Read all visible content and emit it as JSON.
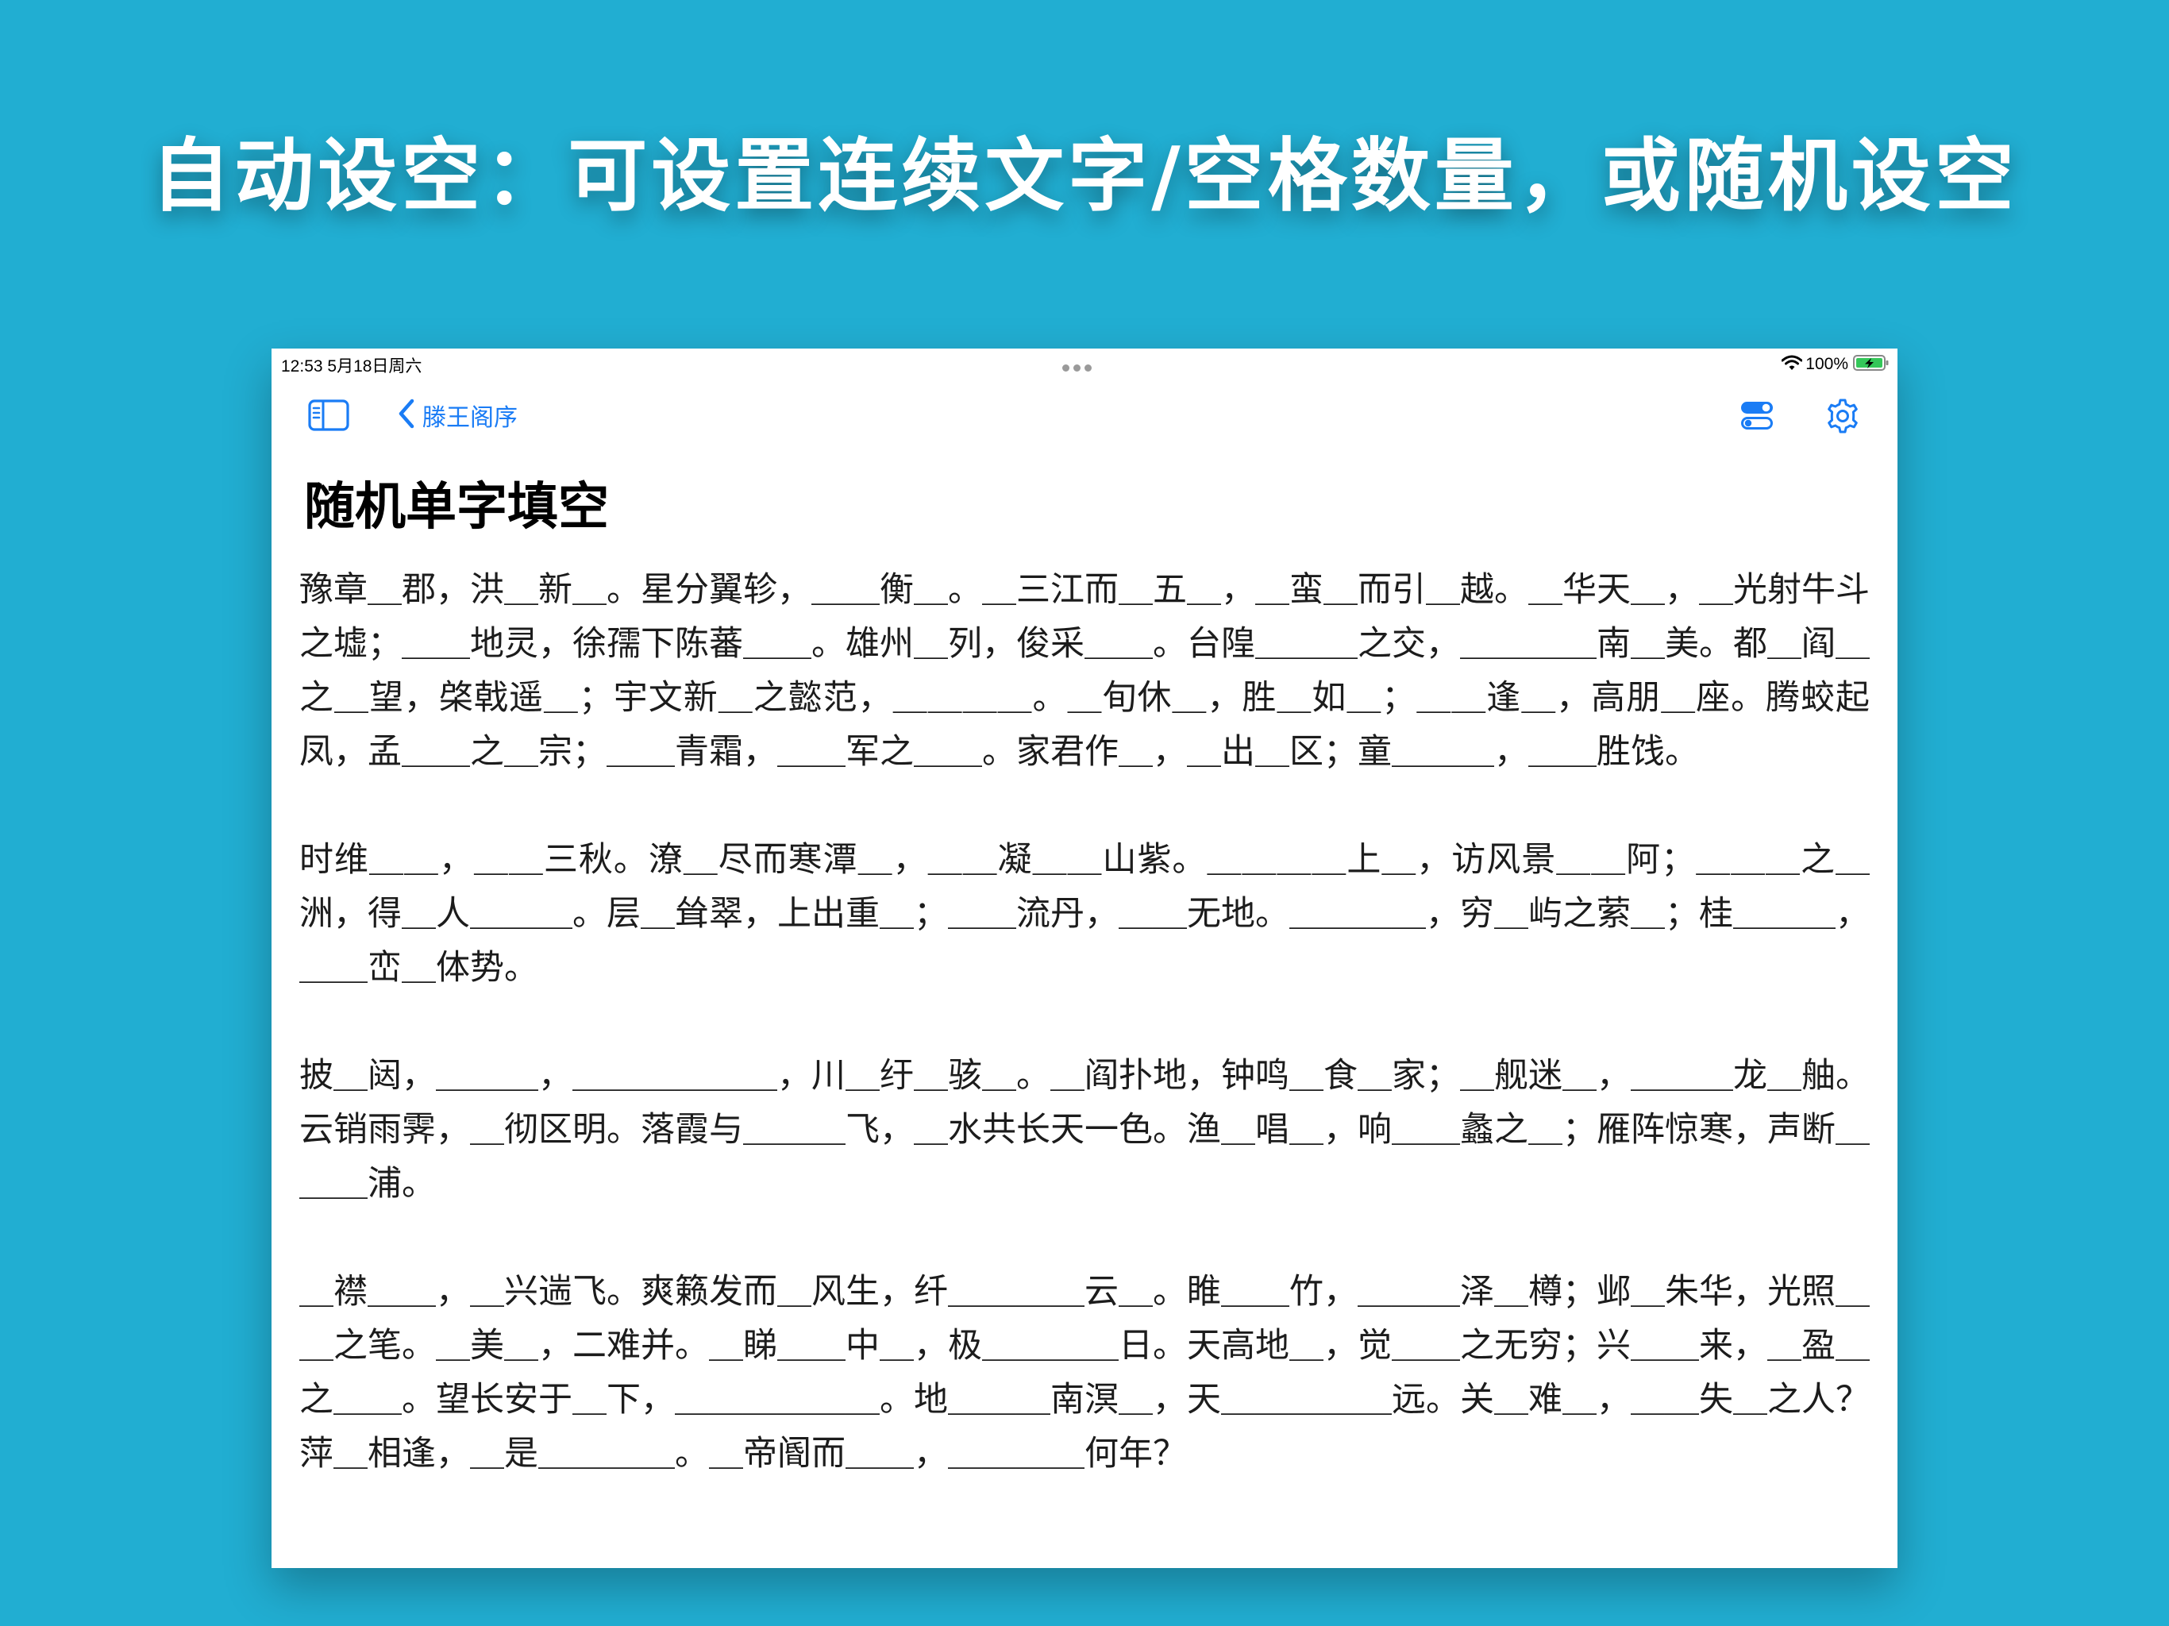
{
  "headline": "自动设空：可设置连续文字/空格数量，或随机设空",
  "status_bar": {
    "time_date": "12:53  5月18日周六",
    "battery": "100%"
  },
  "nav": {
    "back_label": "滕王阁序"
  },
  "page": {
    "title": "随机单字填空"
  },
  "paragraphs": [
    "豫章＿郡，洪＿新＿。星分翼轸，＿＿衡＿。＿三江而＿五＿，＿蛮＿而引＿越。＿华天＿，＿光射牛斗之墟；＿＿地灵，徐孺下陈蕃＿＿。雄州＿列，俊采＿＿。台隍＿＿＿之交，＿＿＿＿南＿美。都＿阎＿之＿望，棨戟遥＿；宇文新＿之懿范，＿＿＿＿。＿旬休＿，胜＿如＿；＿＿逢＿，高朋＿座。腾蛟起凤，孟＿＿之＿宗；＿＿青霜，＿＿军之＿＿。家君作＿，＿出＿区；童＿＿＿，＿＿胜饯。",
    "时维＿＿，＿＿三秋。潦＿尽而寒潭＿，＿＿凝＿＿山紫。＿＿＿＿上＿，访风景＿＿阿；＿＿＿之＿洲，得＿人＿＿＿。层＿耸翠，上出重＿；＿＿流丹，＿＿无地。＿＿＿＿，穷＿屿之萦＿；桂＿＿＿，＿＿峦＿体势。",
    "披＿闼，＿＿＿，＿＿＿＿＿＿，川＿纡＿骇＿。＿阎扑地，钟鸣＿食＿家；＿舰迷＿，＿＿＿龙＿舳。云销雨霁，＿彻区明。落霞与＿＿＿飞，＿水共长天一色。渔＿唱＿，响＿＿蠡之＿；雁阵惊寒，声断＿＿＿浦。",
    "＿襟＿＿，＿兴遄飞。爽籁发而＿风生，纤＿＿＿＿云＿。睢＿＿竹，＿＿＿泽＿樽；邺＿朱华，光照＿＿之笔。＿美＿，二难并。＿睇＿＿中＿，极＿＿＿＿日。天高地＿，觉＿＿之无穷；兴＿＿来，＿盈＿之＿＿。望长安于＿下，＿＿＿＿＿＿。地＿＿＿南溟＿，天＿＿＿＿＿远。关＿难＿，＿＿失＿之人？萍＿相逢，＿是＿＿＿＿。＿帝阍而＿＿，＿＿＿＿何年？"
  ]
}
